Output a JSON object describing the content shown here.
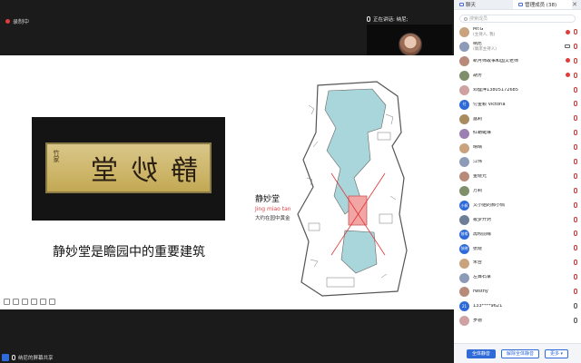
{
  "recording_label": "录制中",
  "speaking_label": "正在讲话: 纳尼;",
  "video_tile_name": "纳尼",
  "share_bar_label": "纳尼的屏幕共享",
  "slide": {
    "caption": "静妙堂是瞻园中的重要建筑",
    "plaque_text": "静妙堂",
    "plaque_side": "竹家",
    "jmt_cn": "静妙堂",
    "jmt_pinyin": "Jing miao tang",
    "jmt_desc": "大约在园中黄金分割处"
  },
  "panel": {
    "tab_chat": "聊天",
    "tab_members": "管理成员 (38)",
    "close_glyph": "✕",
    "search_placeholder": "搜索成员",
    "members": [
      {
        "name": "Mr.G",
        "role": "(主持人, 我)",
        "avatar": "",
        "red": true,
        "cam": false,
        "mic": "mute"
      },
      {
        "name": "纳尼",
        "role": "(联席主持人)",
        "avatar": "",
        "red": false,
        "cam": true,
        "mic": "mute"
      },
      {
        "name": "新月师故事和国文老师",
        "role": "",
        "avatar": "",
        "red": true,
        "cam": false,
        "mic": "mute"
      },
      {
        "name": "胡芳",
        "role": "",
        "avatar": "",
        "red": true,
        "cam": false,
        "mic": "mute"
      },
      {
        "name": "邓健萍13805172685",
        "role": "",
        "avatar": "",
        "red": false,
        "cam": false,
        "mic": "mute"
      },
      {
        "name": "付金颖 Victoria",
        "role": "",
        "avatar": "付",
        "red": false,
        "cam": false,
        "mic": "mute"
      },
      {
        "name": "露莉",
        "role": "",
        "avatar": "",
        "red": false,
        "cam": false,
        "mic": "mute"
      },
      {
        "name": "红蜻蜓琳",
        "role": "",
        "avatar": "",
        "red": false,
        "cam": false,
        "mic": "mute"
      },
      {
        "name": "晴晴",
        "role": "",
        "avatar": "",
        "red": false,
        "cam": false,
        "mic": "mute"
      },
      {
        "name": "江伟",
        "role": "",
        "avatar": "",
        "red": false,
        "cam": false,
        "mic": "mute"
      },
      {
        "name": "金晓兄",
        "role": "",
        "avatar": "",
        "red": false,
        "cam": false,
        "mic": "mute"
      },
      {
        "name": "万莉",
        "role": "",
        "avatar": "",
        "red": false,
        "cam": false,
        "mic": "mute"
      },
      {
        "name": "文小姐的郝小佩",
        "role": "",
        "avatar": "小佩",
        "red": false,
        "cam": false,
        "mic": "mute"
      },
      {
        "name": "筱梦开窍",
        "role": "",
        "avatar": "",
        "red": false,
        "cam": false,
        "mic": "mute"
      },
      {
        "name": "再倾前缘",
        "role": "",
        "avatar": "前缘",
        "red": false,
        "cam": false,
        "mic": "mute"
      },
      {
        "name": "张晓",
        "role": "",
        "avatar": "张晓",
        "red": false,
        "cam": false,
        "mic": "mute"
      },
      {
        "name": "朱台",
        "role": "",
        "avatar": "",
        "red": false,
        "cam": false,
        "mic": "mute"
      },
      {
        "name": "左舞石掌",
        "role": "",
        "avatar": "",
        "red": false,
        "cam": false,
        "mic": "mute"
      },
      {
        "name": "rwsthy",
        "role": "",
        "avatar": "",
        "red": false,
        "cam": false,
        "mic": "mute"
      },
      {
        "name": "133****9621",
        "role": "",
        "avatar": "21",
        "red": false,
        "cam": false,
        "mic": "plain"
      },
      {
        "name": "罗德",
        "role": "",
        "avatar": "",
        "red": false,
        "cam": false,
        "mic": "plain"
      }
    ],
    "btn_mute_all": "全体静音",
    "btn_unmute_all": "解除全体静音",
    "btn_more": "更多 ▾"
  }
}
